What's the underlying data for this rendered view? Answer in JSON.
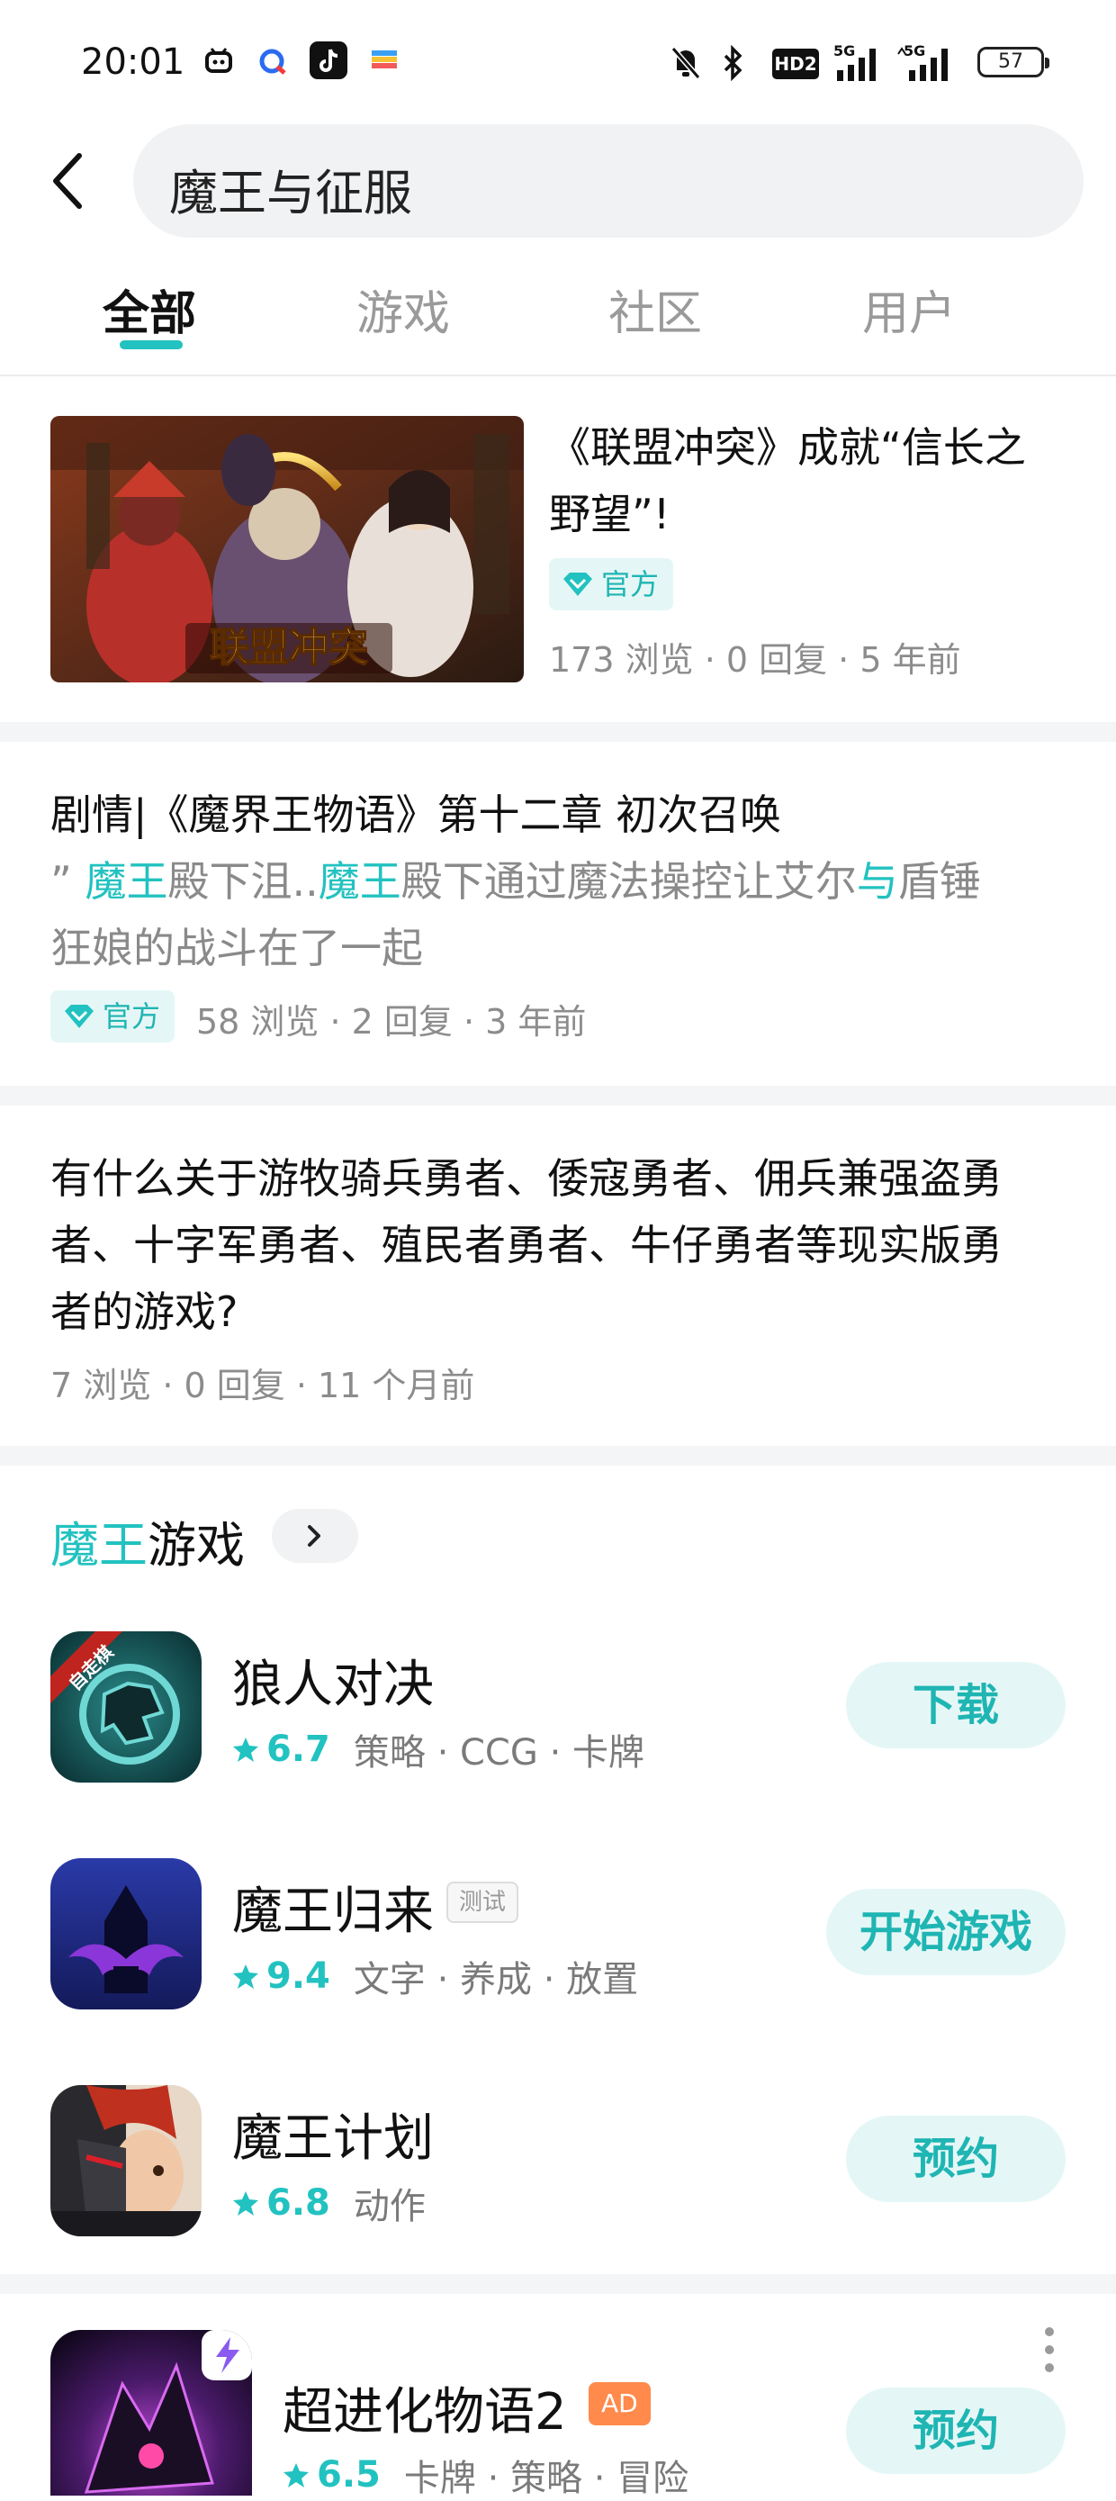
{
  "status_bar": {
    "time": "20:01",
    "battery": "57",
    "network_labels": [
      "HD2",
      "5G",
      "5G"
    ]
  },
  "search": {
    "query": "魔王与征服"
  },
  "tabs": [
    {
      "label": "全部",
      "active": true
    },
    {
      "label": "游戏",
      "active": false
    },
    {
      "label": "社区",
      "active": false
    },
    {
      "label": "用户",
      "active": false
    }
  ],
  "posts": [
    {
      "title": "《联盟冲突》成就“信长之野望”!",
      "title_line1": "《联盟冲突》成就“信长之",
      "title_line2": "野望”!",
      "badge": "官方",
      "meta": "173 浏览 · 0 回复 · 5 年前",
      "image_caption": "联盟冲突"
    },
    {
      "title": "剧情|《魔界王物语》第十二章 初次召唤",
      "snippet_parts": [
        "” ",
        "魔王",
        "殿下沮..",
        "魔王",
        "殿下通过魔法操控让艾尔",
        "与",
        "盾锤"
      ],
      "snippet_line2": "狂娘的战斗在了一起",
      "badge": "官方",
      "meta": "58 浏览 · 2 回复 · 3 年前"
    },
    {
      "title_line1": "有什么关于游牧骑兵勇者、倭寇勇者、佣兵兼强盗勇",
      "title_line2": "者、十字军勇者、殖民者勇者、牛仔勇者等现实版勇",
      "title_line3": "者的游戏?",
      "meta": "7 浏览 · 0 回复 · 11 个月前"
    }
  ],
  "games_section": {
    "title_highlight": "魔王",
    "title_rest": "游戏",
    "games": [
      {
        "name": "狼人对决",
        "rating": "6.7",
        "tags": "策略 · CCG · 卡牌",
        "action": "下载",
        "icon_badge": "自走棋"
      },
      {
        "name": "魔王归来",
        "rating": "9.4",
        "tags": "文字 · 养成 · 放置",
        "action": "开始游戏",
        "tag": "测试"
      },
      {
        "name": "魔王计划",
        "rating": "6.8",
        "tags": "动作",
        "action": "预约"
      }
    ]
  },
  "ad_game": {
    "name": "超进化物语2",
    "ad_label": "AD",
    "rating": "6.5",
    "tags": "卡牌 · 策略 · 冒险",
    "action": "预约"
  },
  "colors": {
    "accent": "#22c2c0",
    "badge_bg": "#e4f7f6",
    "ad": "#ff8a4c"
  }
}
